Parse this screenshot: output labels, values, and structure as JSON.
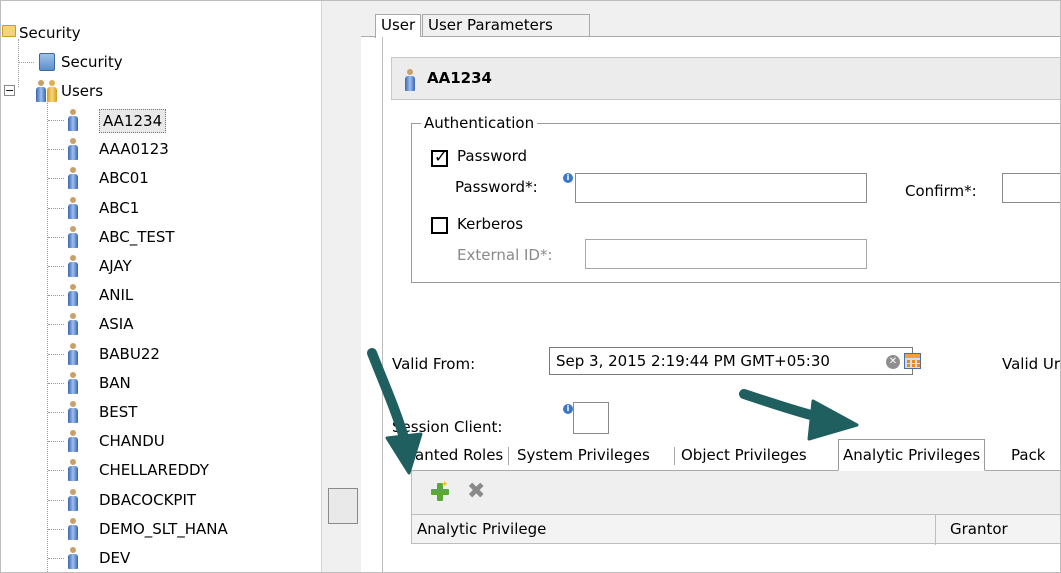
{
  "tree": {
    "root_label": "Security",
    "security_label": "Security",
    "users_label": "Users",
    "users": [
      "AA1234",
      "AAA0123",
      "ABC01",
      "ABC1",
      "ABC_TEST",
      "AJAY",
      "ANIL",
      "ASIA",
      "BABU22",
      "BAN",
      "BEST",
      "CHANDU",
      "CHELLAREDDY",
      "DBACOCKPIT",
      "DEMO_SLT_HANA",
      "DEV"
    ],
    "selected_user": "AA1234"
  },
  "tabs": {
    "user": "User",
    "user_parameters": "User Parameters"
  },
  "user_header": {
    "name": "AA1234"
  },
  "authentication": {
    "legend": "Authentication",
    "password_label": "Password",
    "password_checked": true,
    "password_field_label": "Password*:",
    "password_value": "",
    "confirm_label": "Confirm*:",
    "confirm_value": "",
    "kerberos_label": "Kerberos",
    "kerberos_checked": false,
    "external_id_label": "External ID*:",
    "external_id_value": ""
  },
  "validity": {
    "valid_from_label": "Valid From:",
    "valid_from_value": "Sep 3, 2015 2:19:44 PM GMT+05:30",
    "valid_until_label": "Valid Ur"
  },
  "session": {
    "client_label": "Session Client:",
    "client_value": ""
  },
  "sub_tabs": [
    "anted Roles",
    "System Privileges",
    "Object Privileges",
    "Analytic Privileges",
    "Pack"
  ],
  "active_sub_tab": "Analytic Privileges",
  "table": {
    "columns": [
      "Analytic Privilege",
      "Grantor"
    ]
  },
  "colors": {
    "arrow": "#1f5f5f",
    "header_bg": "#ececec",
    "add_green": "#5aa83a"
  }
}
